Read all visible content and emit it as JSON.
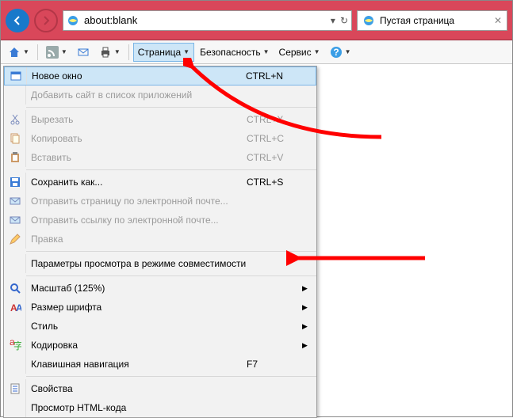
{
  "address": {
    "url": "about:blank"
  },
  "tab": {
    "title": "Пустая страница"
  },
  "toolbar": {
    "page": "Страница",
    "security": "Безопасность",
    "service": "Сервис"
  },
  "menu": {
    "new_window": "Новое окно",
    "new_window_sc": "CTRL+N",
    "add_site": "Добавить сайт в список приложений",
    "cut": "Вырезать",
    "cut_sc": "CTRL+X",
    "copy": "Копировать",
    "copy_sc": "CTRL+C",
    "paste": "Вставить",
    "paste_sc": "CTRL+V",
    "save_as": "Сохранить как...",
    "save_as_sc": "CTRL+S",
    "send_page": "Отправить страницу по электронной почте...",
    "send_link": "Отправить ссылку по электронной почте...",
    "edit": "Правка",
    "compat": "Параметры просмотра в режиме совместимости",
    "zoom": "Масштаб (125%)",
    "font_size": "Размер шрифта",
    "style": "Стиль",
    "encoding": "Кодировка",
    "caret": "Клавишная навигация",
    "caret_sc": "F7",
    "properties": "Свойства",
    "view_source": "Просмотр HTML-кода"
  }
}
